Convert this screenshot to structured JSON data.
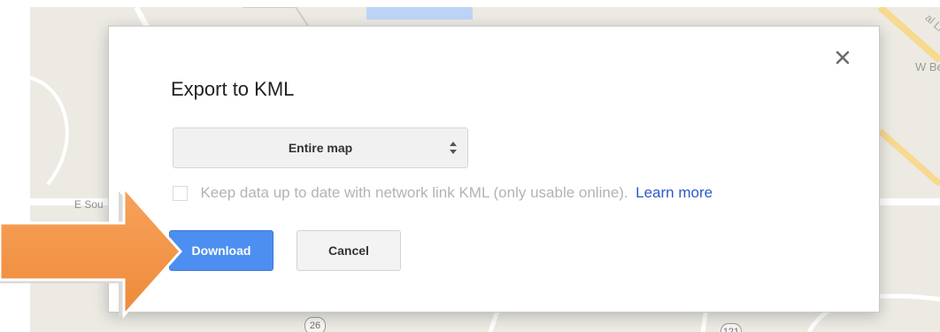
{
  "map": {
    "labels": {
      "east_road": "W Bethel",
      "south_road": "E Sou",
      "lane": "al Ln"
    },
    "shields": {
      "route_a": "26",
      "route_b": "121"
    }
  },
  "dialog": {
    "title": "Export to KML",
    "close_icon": "close-icon",
    "export_select": {
      "selected_value": "Entire map",
      "icon": "updown-arrows-icon"
    },
    "network_link": {
      "label": "Keep data up to date with network link KML (only usable online).",
      "checked": false,
      "learn_more": "Learn more"
    },
    "buttons": {
      "download_label": "Download",
      "cancel_label": "Cancel"
    }
  },
  "annotation": {
    "icon": "orange-pointer-arrow",
    "color": "#f4954a"
  },
  "colors": {
    "primary_button": "#4d8ff0",
    "link": "#2c59c7",
    "map_background": "#eceae3"
  }
}
